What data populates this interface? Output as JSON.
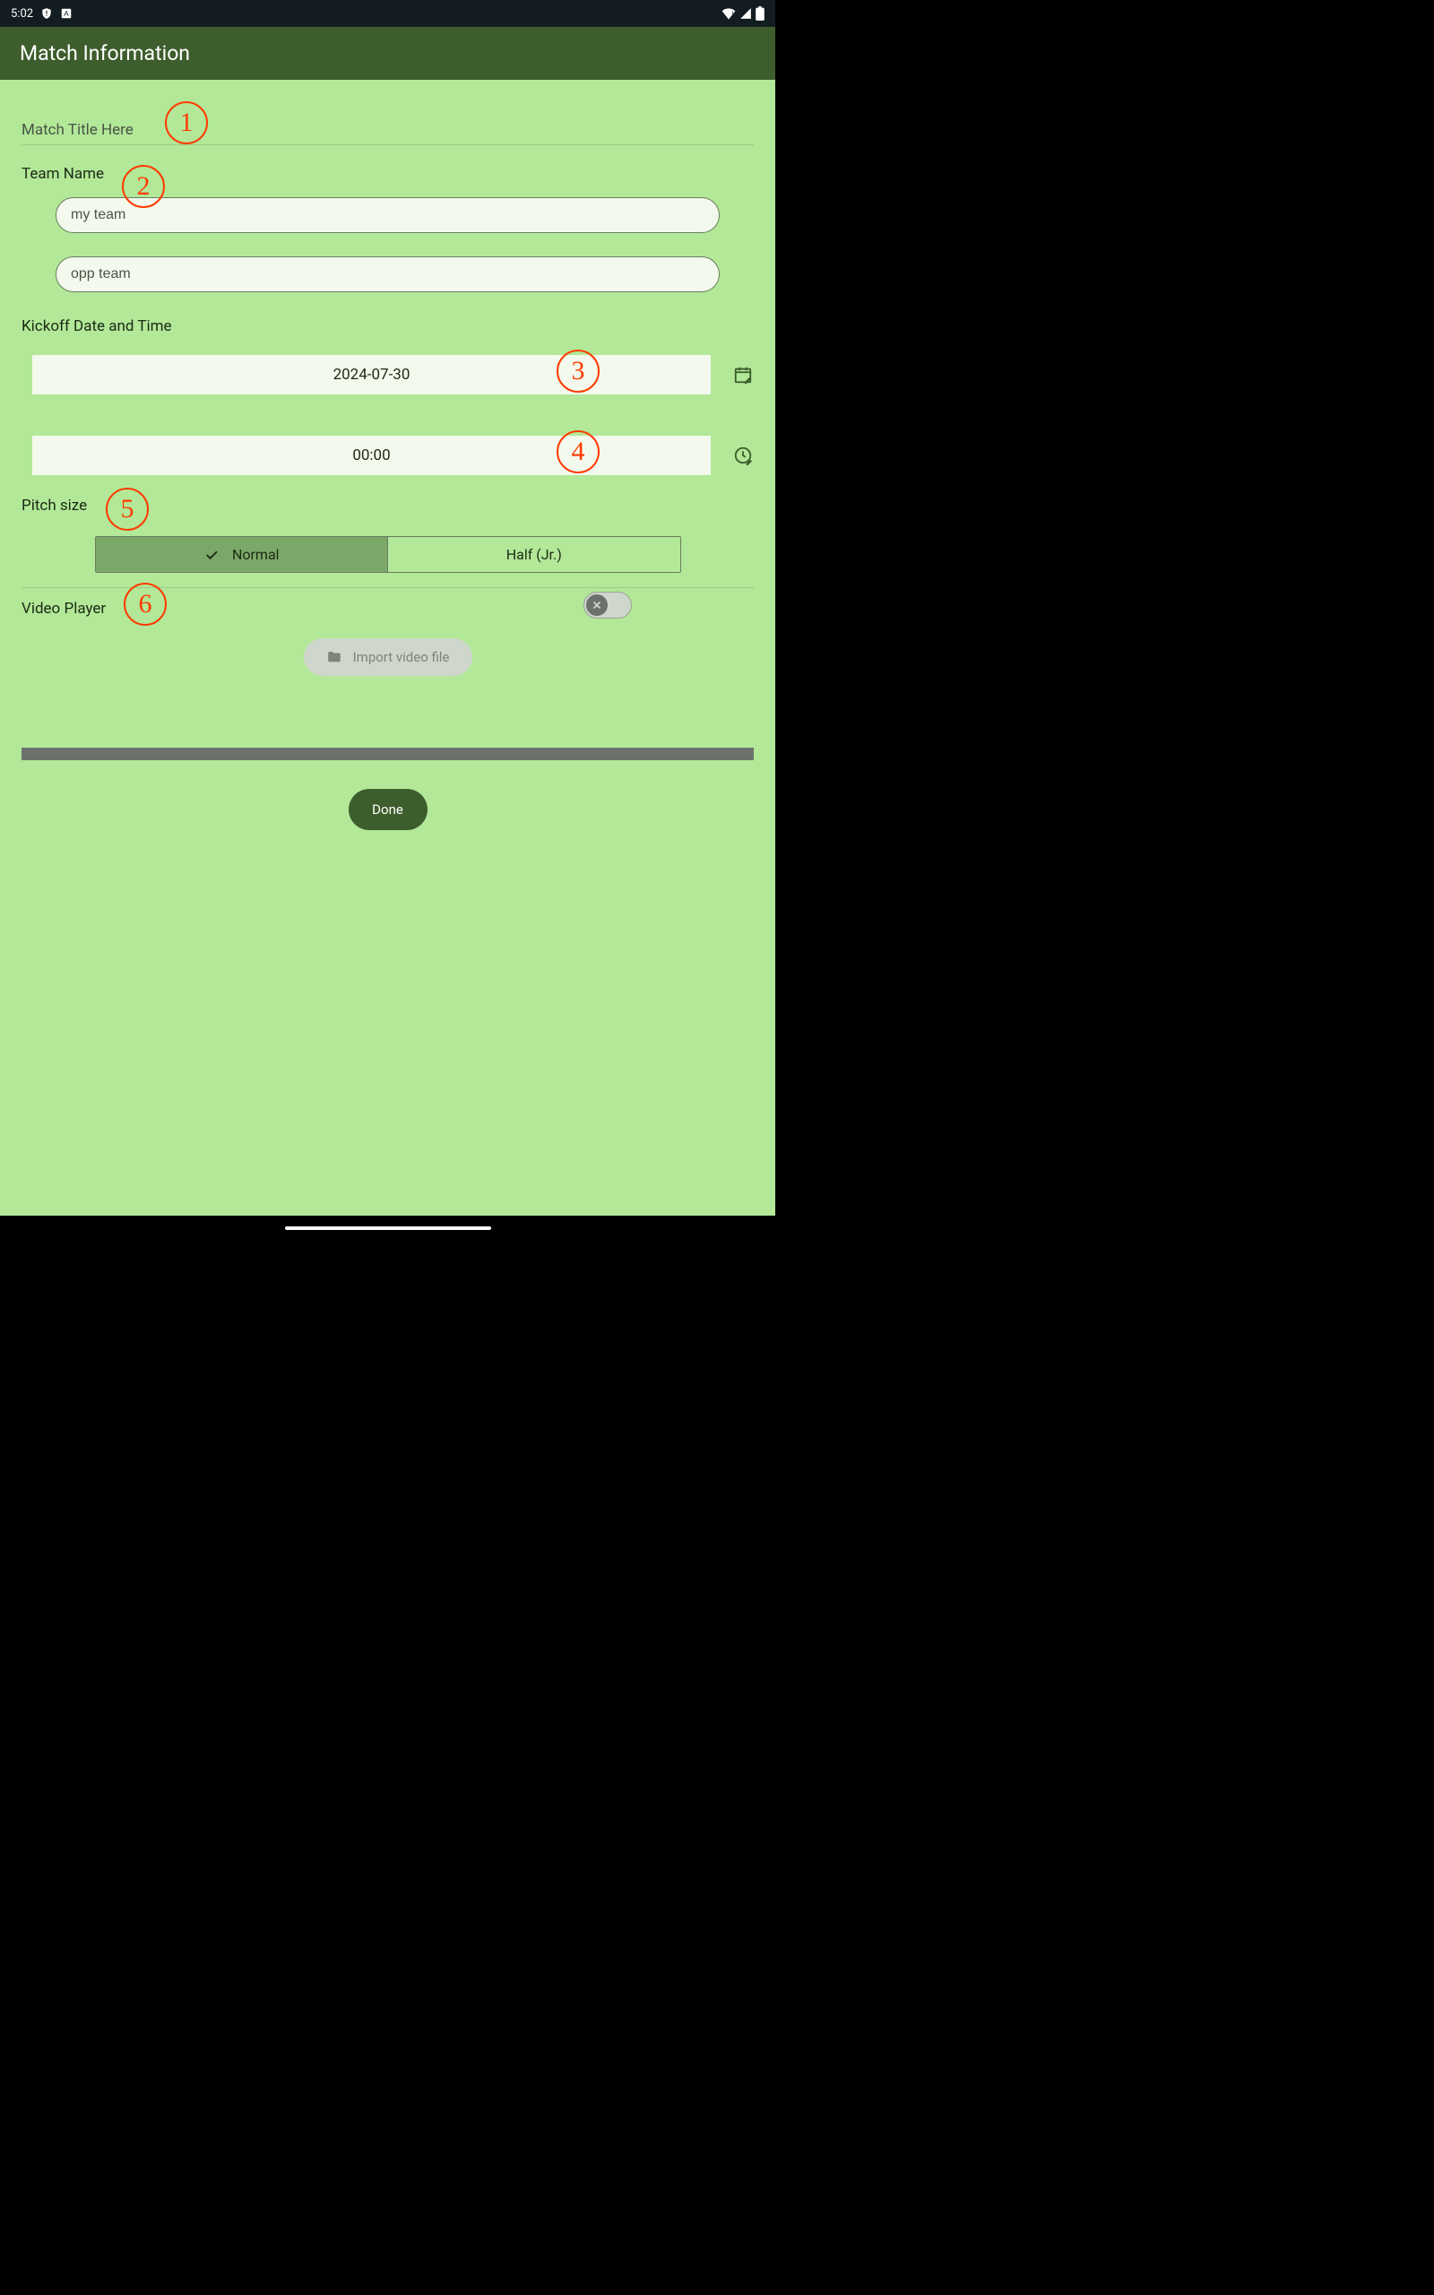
{
  "status": {
    "time": "5:02"
  },
  "header": {
    "title": "Match Information"
  },
  "match_title": {
    "placeholder": "Match Title Here"
  },
  "team": {
    "label": "Team Name",
    "my_value": "my team",
    "opp_value": "opp team"
  },
  "kickoff": {
    "label": "Kickoff Date and Time",
    "date": "2024-07-30",
    "time": "00:00"
  },
  "pitch": {
    "label": "Pitch size",
    "normal": "Normal",
    "half": "Half (Jr.)"
  },
  "video": {
    "label": "Video Player",
    "import": "Import video file"
  },
  "done": "Done",
  "annotations": {
    "a1": "1",
    "a2": "2",
    "a3": "3",
    "a4": "4",
    "a5": "5",
    "a6": "6"
  }
}
